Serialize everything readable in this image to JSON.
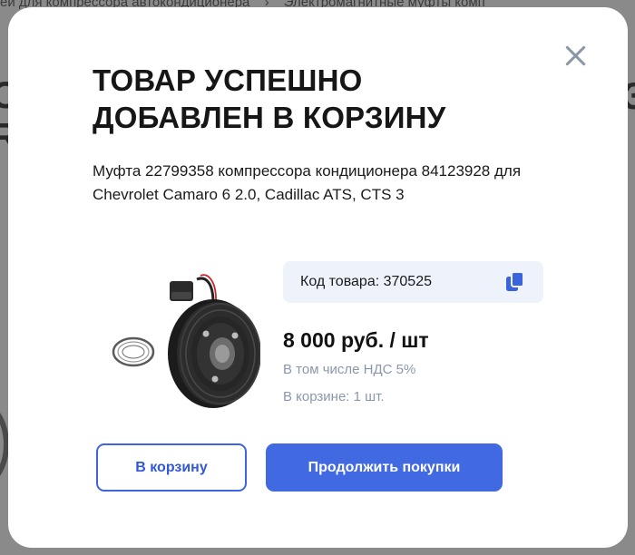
{
  "background": {
    "breadcrumb": [
      "ей для компрессора автокондиционера",
      "›",
      "Электромагнитные муфты комп"
    ],
    "heading_left_lines": [
      "С",
      "R"
    ],
    "heading_right": "З"
  },
  "modal": {
    "title": "ТОВАР УСПЕШНО ДОБАВЛЕН В КОРЗИНУ",
    "product_name": "Муфта 22799358 компрессора кондиционера 84123928 для Chevrolet Camaro 6 2.0, Cadillac ATS, CTS 3",
    "code_label": "Код товара: 370525",
    "price": "8 000 руб. / шт",
    "vat_note": "В том числе НДС 5%",
    "in_cart": "В корзине: 1 шт.",
    "buttons": {
      "cart": "В корзину",
      "continue": "Продолжить покупки"
    },
    "icons": {
      "close": "close-icon",
      "copy": "copy-icon",
      "product": "product-image"
    }
  },
  "colors": {
    "accent": "#4169e1",
    "muted_text": "#8a98ab",
    "code_bg": "#edf2fb",
    "close_icon": "#8a97a6"
  }
}
